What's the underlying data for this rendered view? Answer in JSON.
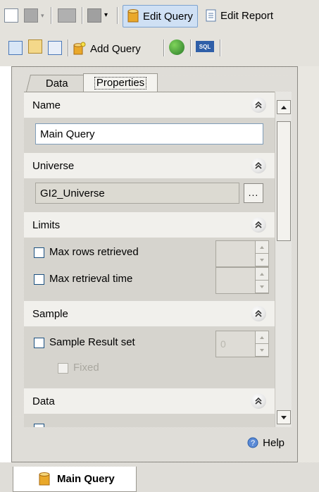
{
  "toolbar_top": {
    "edit_query_label": "Edit Query",
    "edit_report_label": "Edit Report"
  },
  "toolbar_second": {
    "add_query_label": "Add Query",
    "sql_label": "SQL"
  },
  "tabs": {
    "data_label": "Data",
    "properties_label": "Properties"
  },
  "sections": {
    "name": {
      "header": "Name",
      "value": "Main Query"
    },
    "universe": {
      "header": "Universe",
      "value": "GI2_Universe",
      "browse_label": "..."
    },
    "limits": {
      "header": "Limits",
      "max_rows_label": "Max rows retrieved",
      "max_time_label": "Max retrieval time"
    },
    "sample": {
      "header": "Sample",
      "sample_result_label": "Sample Result set",
      "sample_value": "0",
      "fixed_label": "Fixed"
    },
    "data": {
      "header": "Data"
    }
  },
  "help_label": "Help",
  "bottom_tab_label": "Main Query",
  "colors": {
    "section_header_bg": "#f1f0ec",
    "panel_bg": "#d6d4ce",
    "checkbox_border": "#1c5180",
    "active_button_bg": "#cfe0f4"
  }
}
